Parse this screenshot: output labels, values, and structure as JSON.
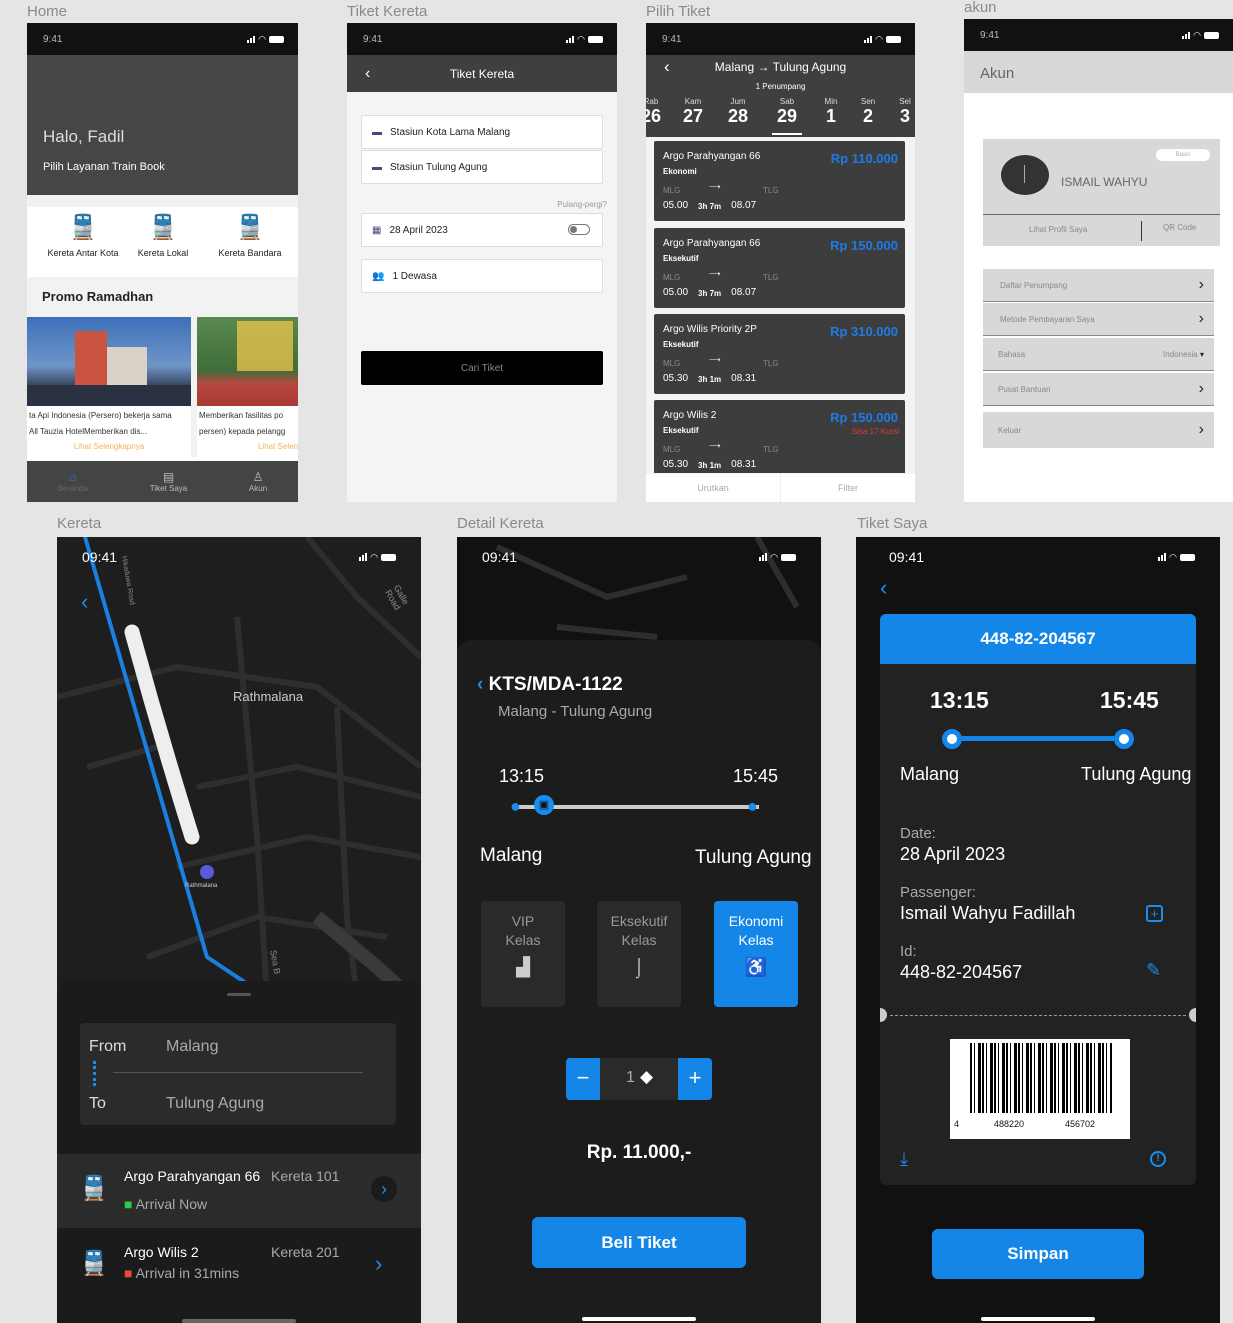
{
  "frame_labels": {
    "home": "Home",
    "tiket": "Tiket Kereta",
    "pilih": "Pilih Tiket",
    "akun": "akun",
    "kereta": "Kereta",
    "detail": "Detail Kereta",
    "tiketsaya": "Tiket Saya"
  },
  "status": {
    "time_small": "9:41",
    "time_large": "09:41"
  },
  "home": {
    "greeting": "Halo, Fadil",
    "subtitle": "Pilih Layanan Train Book",
    "services": [
      "Kereta Antar Kota",
      "Kereta Lokal",
      "Kereta Bandara"
    ],
    "promo_title": "Promo Ramadhan",
    "promo1_text1": "ta Api Indonesia (Persero) bekerja sama",
    "promo1_text2": "All Tauzia HotelMemberikan dis...",
    "promo1_link": "Lihat Selengkapnya",
    "promo2_text1": "Memberikan fasilitas po",
    "promo2_text2": "persen) kepada pelangg",
    "promo2_link": "Lihat Selen",
    "nav": [
      "Beranda",
      "Tiket Saya",
      "Akun"
    ]
  },
  "tiket": {
    "title": "Tiket Kereta",
    "from": "Stasiun Kota Lama Malang",
    "to": "Stasiun Tulung Agung",
    "return_label": "Pulang-pergi?",
    "date": "28 April 2023",
    "passengers": "1 Dewasa",
    "search_button": "Cari Tiket"
  },
  "pilih": {
    "route_from": "Malang",
    "route_to": "Tulung Agung",
    "passengers": "1 Penumpang",
    "days": [
      {
        "n": "Rab",
        "d": "26"
      },
      {
        "n": "Kam",
        "d": "27"
      },
      {
        "n": "Jum",
        "d": "28"
      },
      {
        "n": "Sab",
        "d": "29"
      },
      {
        "n": "Min",
        "d": "1"
      },
      {
        "n": "Sen",
        "d": "2"
      },
      {
        "n": "Sel",
        "d": "3"
      }
    ],
    "tickets": [
      {
        "name": "Argo Parahyangan 66",
        "class": "Ekonomi",
        "price": "Rp 110.000",
        "from": "MLG",
        "to": "TLG",
        "dep": "05.00",
        "dur": "3h 7m",
        "arr": "08.07",
        "note": ""
      },
      {
        "name": "Argo Parahyangan 66",
        "class": "Eksekutif",
        "price": "Rp 150.000",
        "from": "MLG",
        "to": "TLG",
        "dep": "05.00",
        "dur": "3h 7m",
        "arr": "08.07",
        "note": ""
      },
      {
        "name": "Argo Wilis Priority 2P",
        "class": "Eksekutif",
        "price": "Rp 310.000",
        "from": "MLG",
        "to": "TLG",
        "dep": "05.30",
        "dur": "3h 1m",
        "arr": "08.31",
        "note": ""
      },
      {
        "name": "Argo Wilis 2",
        "class": "Eksekutif",
        "price": "Rp 150.000",
        "from": "MLG",
        "to": "TLG",
        "dep": "05.30",
        "dur": "3h 1m",
        "arr": "08.31",
        "note": "Sisa 17 Kursi"
      }
    ],
    "sort": "Urutkan",
    "filter": "Filter"
  },
  "akun": {
    "title": "Akun",
    "name": "ISMAIL WAHYU",
    "badge": "Basic",
    "profile_link": "Lihat Profil Saya",
    "qr": "QR Code",
    "menu": [
      "Daftar Penumpang",
      "Metode Pembayaran Saya",
      "Bahasa",
      "Pusat Bantuan",
      "Keluar"
    ],
    "language": "Indonesia"
  },
  "kereta": {
    "map_label": "Rathmalana",
    "station_label": "Rathmalana",
    "road1": "Galle Road",
    "road2": "Hikaduwa Road",
    "road3": "Sea B",
    "from_label": "From",
    "from_value": "Malang",
    "to_label": "To",
    "to_value": "Tulung Agung",
    "trains": [
      {
        "name": "Argo Parahyangan 66",
        "code": "Kereta 101",
        "status": "Arrival Now",
        "status_color": "#2ecc40"
      },
      {
        "name": "Argo Wilis 2",
        "code": "Kereta 201",
        "status": "Arrival in 31mins",
        "status_color": "#e74c3c"
      }
    ]
  },
  "detail": {
    "code": "KTS/MDA-1122",
    "route": "Malang - Tulung Agung",
    "dep_time": "13:15",
    "arr_time": "15:45",
    "from": "Malang",
    "to": "Tulung Agung",
    "classes": [
      {
        "l1": "VIP",
        "l2": "Kelas"
      },
      {
        "l1": "Eksekutif",
        "l2": "Kelas"
      },
      {
        "l1": "Ekonomi",
        "l2": "Kelas"
      }
    ],
    "qty": "1",
    "price": "Rp. 11.000,-",
    "buy_button": "Beli Tiket"
  },
  "tiketsaya": {
    "ticket_id": "448-82-204567",
    "dep_time": "13:15",
    "arr_time": "15:45",
    "from": "Malang",
    "to": "Tulung Agung",
    "date_label": "Date:",
    "date": "28 April 2023",
    "passenger_label": "Passenger:",
    "passenger": "Ismail Wahyu Fadillah",
    "id_label": "Id:",
    "id": "448-82-204567",
    "barcode_nums": [
      "4",
      "488220",
      "456702"
    ],
    "save_button": "Simpan"
  },
  "colors": {
    "accent": "#1486e8",
    "dark_bg": "#1a1a1a",
    "gray_header": "#3f3f3f"
  }
}
